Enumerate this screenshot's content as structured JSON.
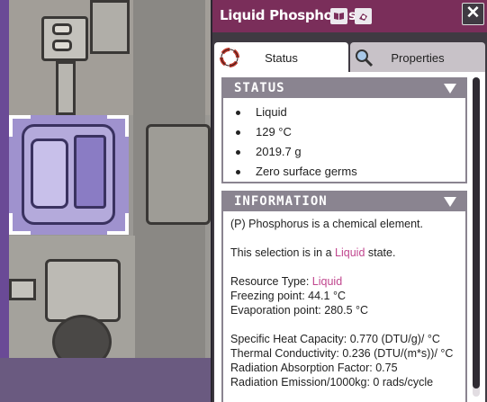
{
  "panel": {
    "title": "Liquid Phosphorus",
    "close_label": "✕",
    "tabs": [
      {
        "label": "Status",
        "active": true
      },
      {
        "label": "Properties",
        "active": false
      }
    ]
  },
  "status": {
    "header": "STATUS",
    "items": [
      "Liquid",
      "129 °C",
      "2019.7 g",
      "Zero surface germs"
    ]
  },
  "information": {
    "header": "INFORMATION",
    "description": "(P) Phosphorus is a chemical element.",
    "state_prefix": "This selection is in a ",
    "state_value": "Liquid",
    "state_suffix": " state.",
    "resource_type_label": "Resource Type: ",
    "resource_type_value": "Liquid",
    "freezing_point": "Freezing point: 44.1 °C",
    "evaporation_point": "Evaporation point: 280.5 °C",
    "specific_heat": "Specific Heat Capacity: 0.770 (DTU/g)/ °C",
    "thermal_conductivity": "Thermal Conductivity: 0.236 (DTU/(m*s))/ °C",
    "radiation_absorption": "Radiation Absorption Factor: 0.75",
    "radiation_emission": "Radiation Emission/1000kg: 0 rads/cycle"
  },
  "colors": {
    "title_bar": "#7a2e5a",
    "highlight": "#c0468e",
    "selection": "#a090d8",
    "section_header": "#8a8490"
  }
}
